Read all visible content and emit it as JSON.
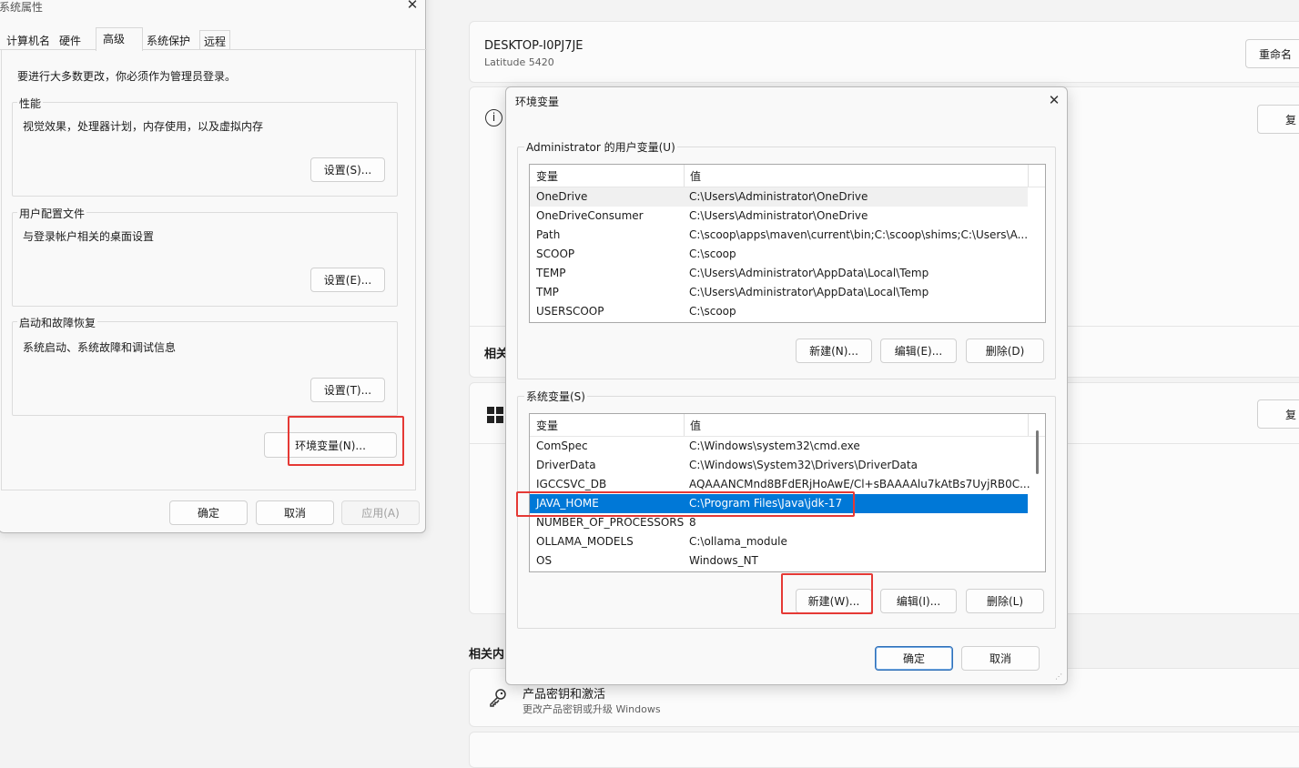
{
  "sysprops": {
    "title": "系统属性",
    "tabs": [
      {
        "label": "计算机名"
      },
      {
        "label": "硬件"
      },
      {
        "label": "高级"
      },
      {
        "label": "系统保护"
      },
      {
        "label": "远程"
      }
    ],
    "admin_note": "要进行大多数更改，你必须作为管理员登录。",
    "perf": {
      "title": "性能",
      "desc": "视觉效果，处理器计划，内存使用，以及虚拟内存",
      "button": "设置(S)..."
    },
    "profile": {
      "title": "用户配置文件",
      "desc": "与登录帐户相关的桌面设置",
      "button": "设置(E)..."
    },
    "startup": {
      "title": "启动和故障恢复",
      "desc": "系统启动、系统故障和调试信息",
      "button": "设置(T)..."
    },
    "env_button": "环境变量(N)...",
    "ok": "确定",
    "cancel": "取消",
    "apply": "应用(A)"
  },
  "settings": {
    "device_name": "DESKTOP-I0PJ7JE",
    "model": "Latitude 5420",
    "rename_button": "重命名",
    "copy_button_1": "复",
    "related_label": "相关",
    "copy_button_2": "复",
    "related_content": "相关内",
    "product_key_title": "产品密钥和激活",
    "product_key_desc": "更改产品密钥或升级 Windows"
  },
  "envdlg": {
    "title": "环境变量",
    "user_group_label": "Administrator 的用户变量(U)",
    "col_name": "变量",
    "col_value": "值",
    "user_vars": [
      {
        "name": "OneDrive",
        "value": "C:\\Users\\Administrator\\OneDrive"
      },
      {
        "name": "OneDriveConsumer",
        "value": "C:\\Users\\Administrator\\OneDrive"
      },
      {
        "name": "Path",
        "value": "C:\\scoop\\apps\\maven\\current\\bin;C:\\scoop\\shims;C:\\Users\\A..."
      },
      {
        "name": "SCOOP",
        "value": "C:\\scoop"
      },
      {
        "name": "TEMP",
        "value": "C:\\Users\\Administrator\\AppData\\Local\\Temp"
      },
      {
        "name": "TMP",
        "value": "C:\\Users\\Administrator\\AppData\\Local\\Temp"
      },
      {
        "name": "USERSCOOP",
        "value": "C:\\scoop"
      }
    ],
    "user_new": "新建(N)...",
    "user_edit": "编辑(E)...",
    "user_delete": "删除(D)",
    "sys_group_label": "系统变量(S)",
    "sys_vars": [
      {
        "name": "ComSpec",
        "value": "C:\\Windows\\system32\\cmd.exe"
      },
      {
        "name": "DriverData",
        "value": "C:\\Windows\\System32\\Drivers\\DriverData"
      },
      {
        "name": "IGCCSVC_DB",
        "value": "AQAAANCMnd8BFdERjHoAwE/Cl+sBAAAAlu7kAtBs7UyjRB0C..."
      },
      {
        "name": "JAVA_HOME",
        "value": "C:\\Program Files\\Java\\jdk-17"
      },
      {
        "name": "NUMBER_OF_PROCESSORS",
        "value": "8"
      },
      {
        "name": "OLLAMA_MODELS",
        "value": "C:\\ollama_module"
      },
      {
        "name": "OS",
        "value": "Windows_NT"
      }
    ],
    "sys_new": "新建(W)...",
    "sys_edit": "编辑(I)...",
    "sys_delete": "删除(L)",
    "ok": "确定",
    "cancel": "取消"
  }
}
